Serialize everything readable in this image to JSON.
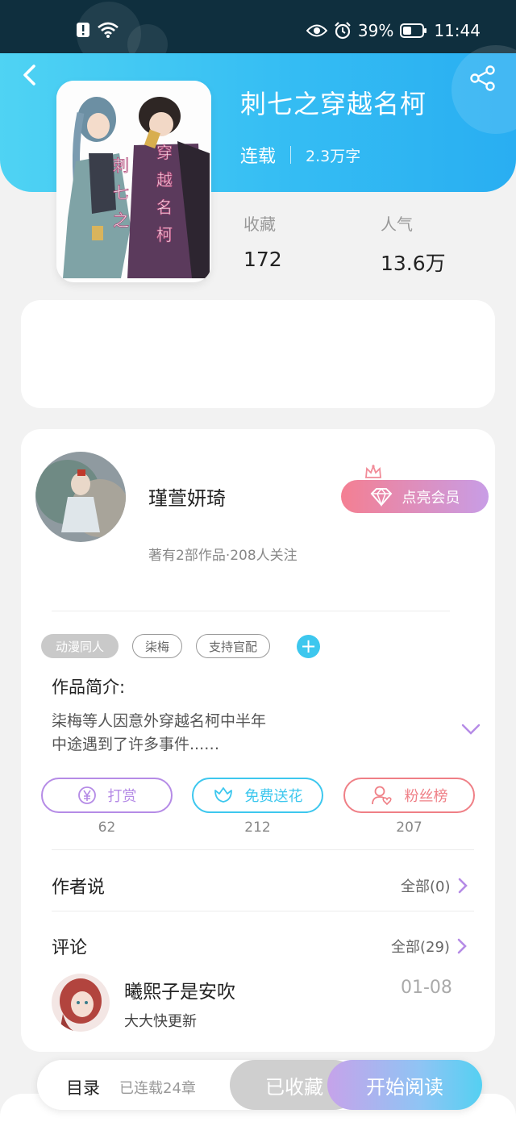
{
  "status_bar": {
    "battery": "39%",
    "time": "11:44"
  },
  "book": {
    "title": "刺七之穿越名柯",
    "status": "连载",
    "word_count": "2.3万字",
    "cover_text_left": "刺七之",
    "cover_text_right": "穿越名柯",
    "stats": [
      {
        "label": "收藏",
        "value": "172"
      },
      {
        "label": "人气",
        "value": "13.6万"
      }
    ]
  },
  "author": {
    "name": "瑾萱妍琦",
    "info": "著有2部作品·208人关注",
    "vip_button": "点亮会员"
  },
  "tags": [
    "动漫同人",
    "柒梅",
    "支持官配"
  ],
  "intro": {
    "label": "作品简介:",
    "line1": "柒梅等人因意外穿越名柯中半年",
    "line2": "中途遇到了许多事件...…"
  },
  "actions": [
    {
      "label": "打赏",
      "count": "62",
      "color": "#b58be6"
    },
    {
      "label": "免费送花",
      "count": "212",
      "color": "#3dc7ee"
    },
    {
      "label": "粉丝榜",
      "count": "207",
      "color": "#ef7f86"
    }
  ],
  "author_says": {
    "title": "作者说",
    "link": "全部(0)"
  },
  "comments": {
    "title": "评论",
    "link": "全部(29)",
    "first": {
      "user": "曦熙子是安吹",
      "text": "大大快更新",
      "date": "01-08"
    }
  },
  "bottom": {
    "toc": "目录",
    "toc_info": "已连载24章",
    "collected": "已收藏",
    "read": "开始阅读"
  }
}
